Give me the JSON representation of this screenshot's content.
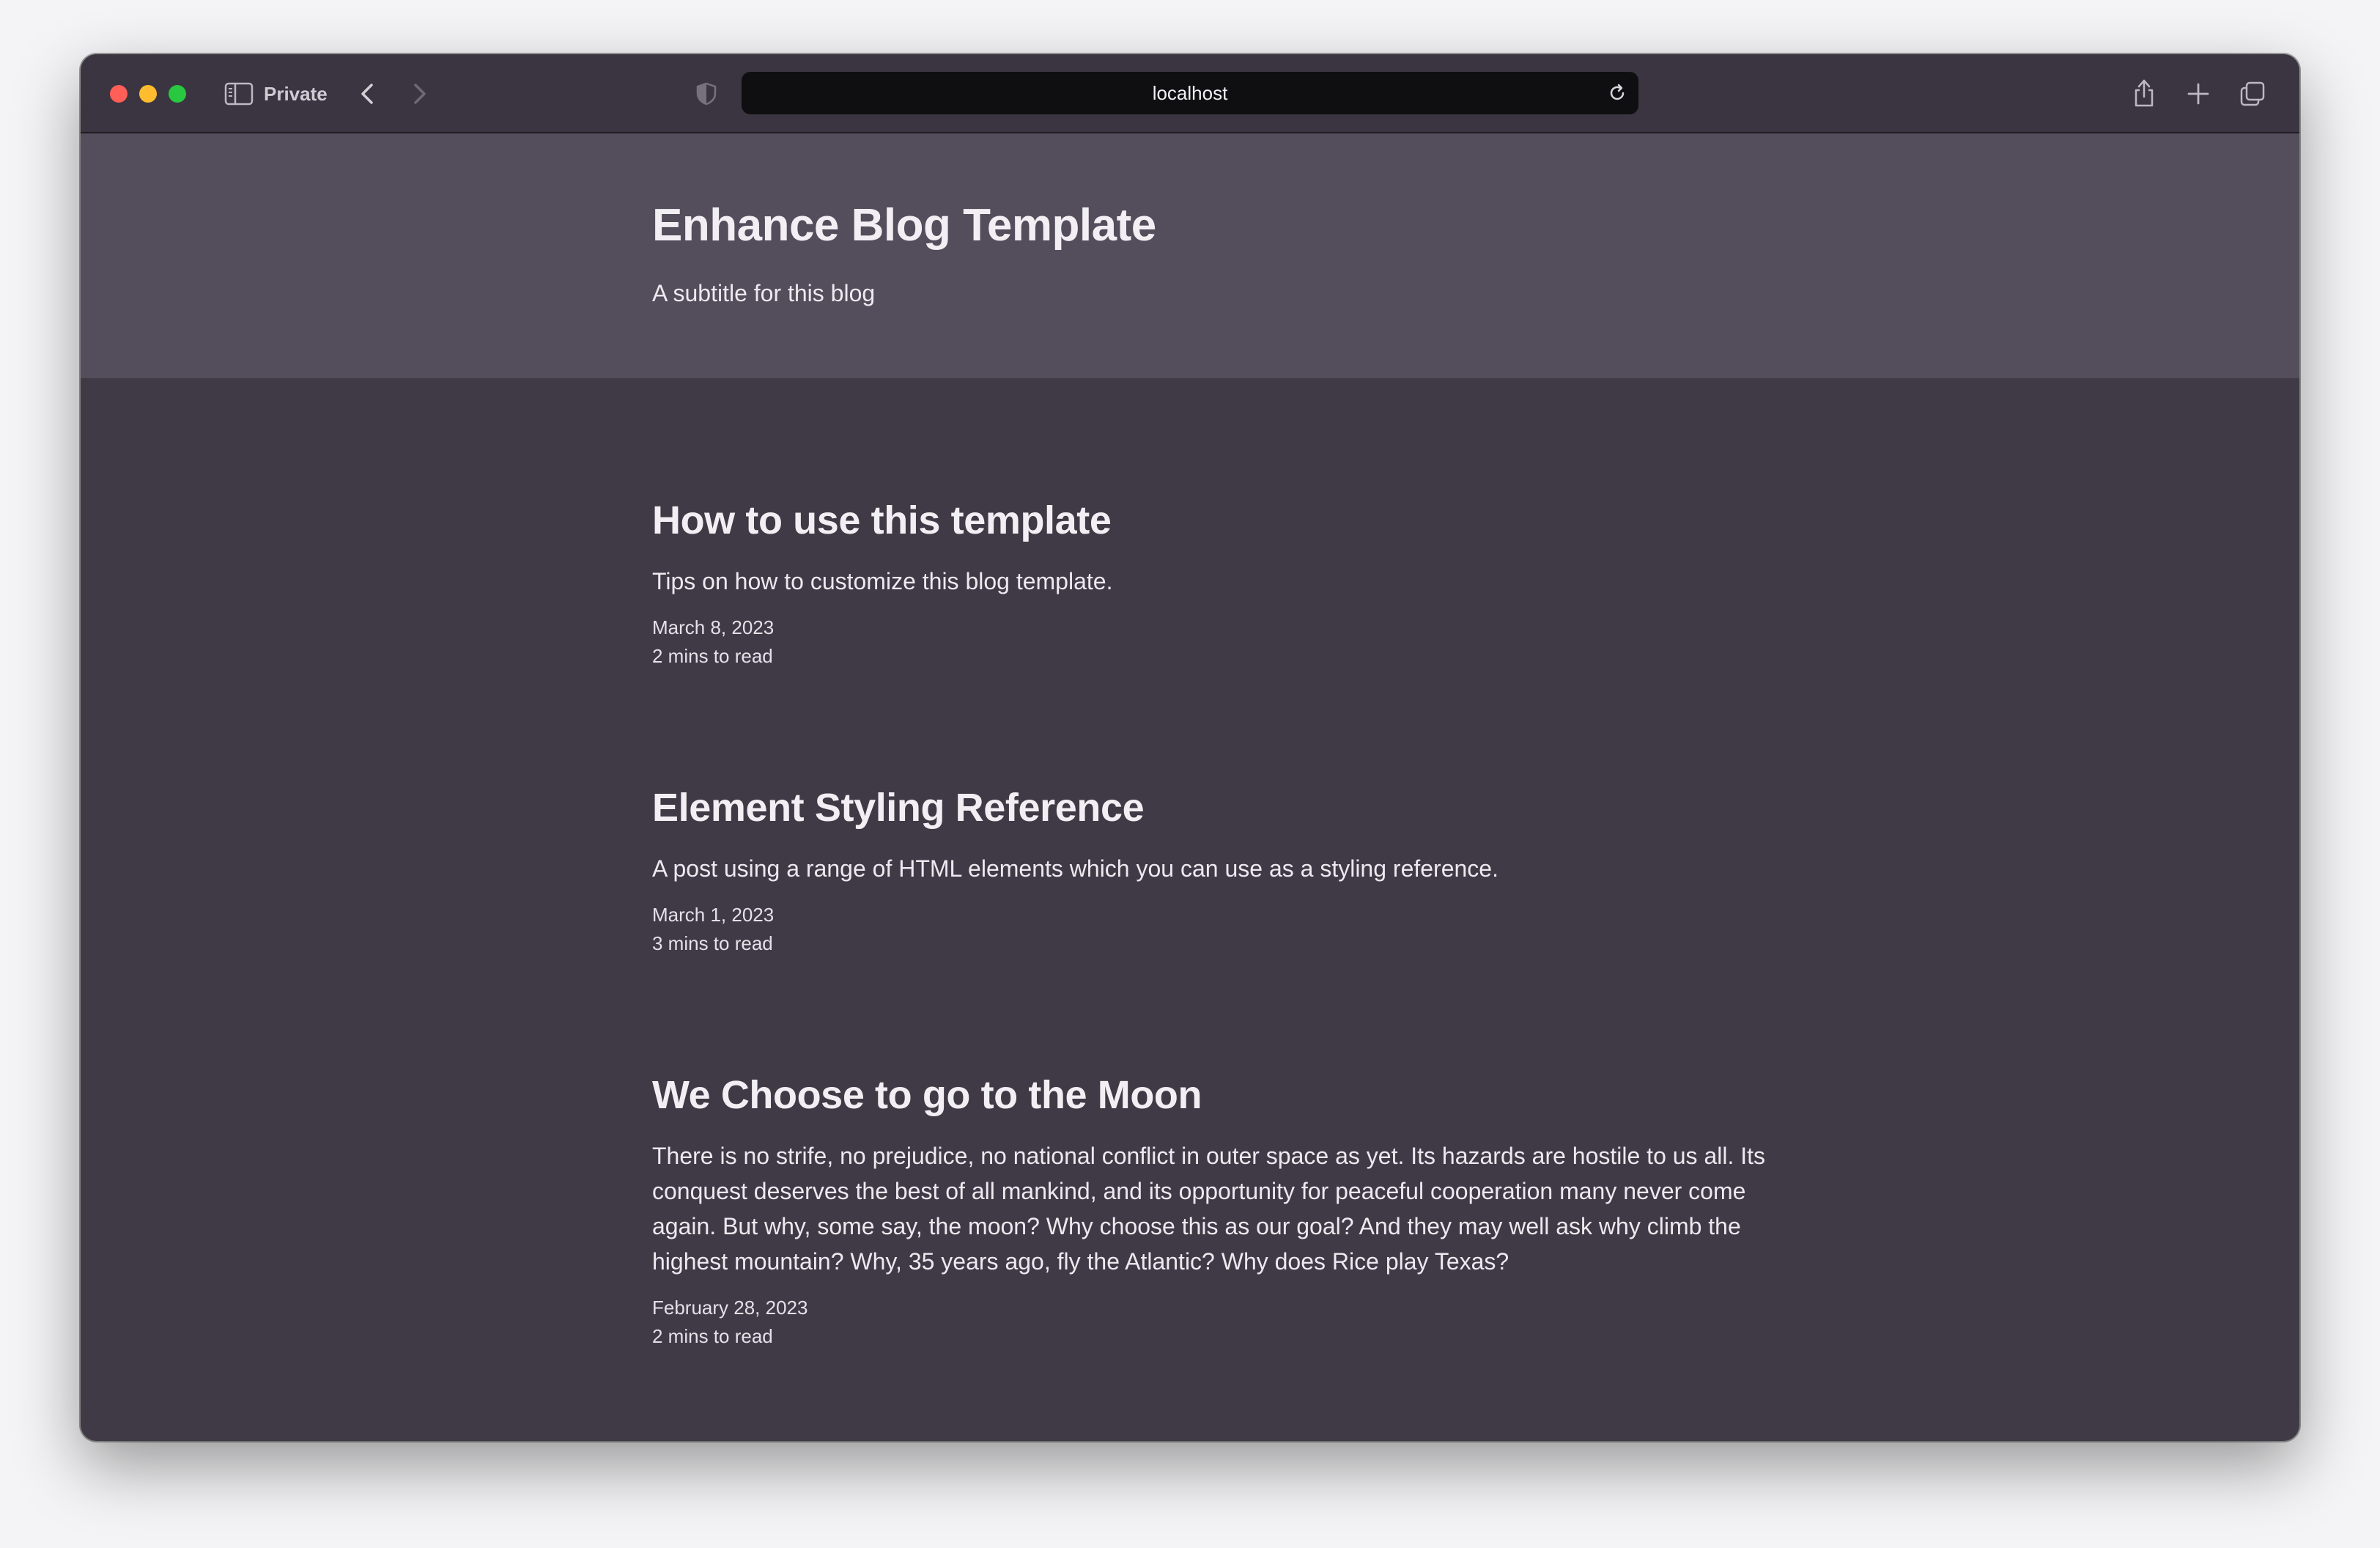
{
  "browser": {
    "mode_label": "Private",
    "url": "localhost",
    "traffic_colors": {
      "close": "#ff5f57",
      "minimize": "#febc2e",
      "maximize": "#28c840"
    }
  },
  "site": {
    "title": "Enhance Blog Template",
    "subtitle": "A subtitle for this blog"
  },
  "posts": [
    {
      "title": "How to use this template",
      "summary": "Tips on how to customize this blog template.",
      "date": "March 8, 2023",
      "read_time": "2 mins to read"
    },
    {
      "title": "Element Styling Reference",
      "summary": "A post using a range of HTML elements which you can use as a styling reference.",
      "date": "March 1, 2023",
      "read_time": "3 mins to read"
    },
    {
      "title": "We Choose to go to the Moon",
      "summary": "There is no strife, no prejudice, no national conflict in outer space as yet. Its hazards are hostile to us all. Its conquest deserves the best of all mankind, and its opportunity for peaceful cooperation many never come again. But why, some say, the moon? Why choose this as our goal? And they may well ask why climb the highest mountain? Why, 35 years ago, fly the Atlantic? Why does Rice play Texas?",
      "date": "February 28, 2023",
      "read_time": "2 mins to read"
    }
  ],
  "icons": [
    "sidebar-icon",
    "back-icon",
    "forward-icon",
    "shield-icon",
    "reload-icon",
    "share-icon",
    "new-tab-icon",
    "tabs-overview-icon"
  ]
}
